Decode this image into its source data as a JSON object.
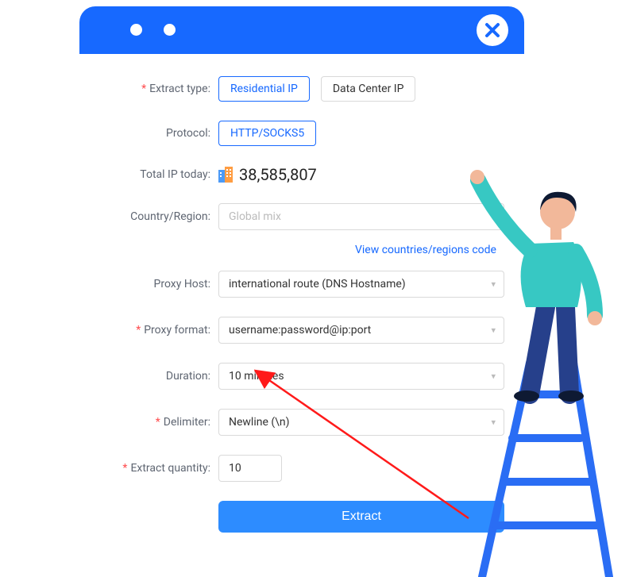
{
  "labels": {
    "extract_type": "Extract type:",
    "protocol": "Protocol:",
    "total_ip": "Total IP today:",
    "country": "Country/Region:",
    "countries_link": "View countries/regions code",
    "proxy_host": "Proxy Host:",
    "proxy_format": "Proxy format:",
    "duration": "Duration:",
    "delimiter": "Delimiter:",
    "extract_qty": "Extract quantity:"
  },
  "extract_type": {
    "options": [
      "Residential IP",
      "Data Center IP"
    ],
    "selected": "Residential IP"
  },
  "protocol": {
    "options": [
      "HTTP/SOCKS5"
    ],
    "selected": "HTTP/SOCKS5"
  },
  "total_ip_value": "38,585,807",
  "country": {
    "placeholder": "Global mix",
    "value": ""
  },
  "proxy_host": {
    "value": "international route (DNS Hostname)"
  },
  "proxy_format": {
    "value": "username:password@ip:port"
  },
  "duration": {
    "value": "10 minutes"
  },
  "delimiter": {
    "value": "Newline (\\n)"
  },
  "extract_qty": {
    "value": "10"
  },
  "extract_button": "Extract",
  "colors": {
    "primary": "#1769ff",
    "button": "#2d8cff",
    "required": "#ff4d4f"
  }
}
